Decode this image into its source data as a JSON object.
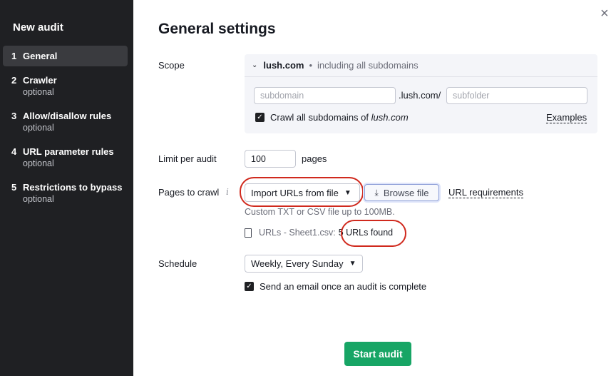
{
  "sidebar": {
    "title": "New audit",
    "steps": [
      {
        "num": "1",
        "label": "General",
        "sub": ""
      },
      {
        "num": "2",
        "label": "Crawler",
        "sub": "optional"
      },
      {
        "num": "3",
        "label": "Allow/disallow rules",
        "sub": "optional"
      },
      {
        "num": "4",
        "label": "URL parameter rules",
        "sub": "optional"
      },
      {
        "num": "5",
        "label": "Restrictions to bypass",
        "sub": "optional"
      }
    ]
  },
  "main": {
    "title": "General settings",
    "close_icon": "×",
    "scope": {
      "label": "Scope",
      "domain": "lush.com",
      "dot": "•",
      "note": "including all subdomains",
      "subdomain_placeholder": "subdomain",
      "mid_text": ".lush.com/",
      "subfolder_placeholder": "subfolder",
      "crawl_all_prefix": "Crawl all subdomains of ",
      "crawl_all_domain": "lush.com",
      "examples_link": "Examples"
    },
    "limit": {
      "label": "Limit per audit",
      "value": "100",
      "unit": "pages"
    },
    "pages": {
      "label": "Pages to crawl",
      "info": "i",
      "source_select": "Import URLs from file",
      "browse_button": "Browse file",
      "requirements_link": "URL requirements",
      "hint": "Custom TXT or CSV file up to 100MB.",
      "file_name": "URLs - Sheet1.csv:",
      "found_text": "5 URLs found"
    },
    "schedule": {
      "label": "Schedule",
      "select": "Weekly, Every Sunday",
      "email_checkbox": "Send an email once an audit is complete"
    },
    "start_button": "Start audit"
  },
  "colors": {
    "sidebar_bg": "#1f2023",
    "accent_green": "#17a565",
    "highlight_red": "#d0291d"
  }
}
